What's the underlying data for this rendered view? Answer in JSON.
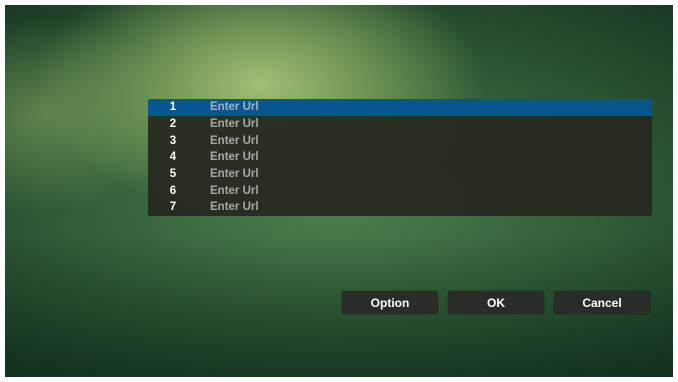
{
  "url_list": {
    "selected_index": 0,
    "rows": [
      {
        "number": "1",
        "placeholder": "Enter Url"
      },
      {
        "number": "2",
        "placeholder": "Enter Url"
      },
      {
        "number": "3",
        "placeholder": "Enter Url"
      },
      {
        "number": "4",
        "placeholder": "Enter Url"
      },
      {
        "number": "5",
        "placeholder": "Enter Url"
      },
      {
        "number": "6",
        "placeholder": "Enter Url"
      },
      {
        "number": "7",
        "placeholder": "Enter Url"
      }
    ]
  },
  "buttons": {
    "option_label": "Option",
    "ok_label": "OK",
    "cancel_label": "Cancel"
  },
  "colors": {
    "selection": "#07568f",
    "list_background": "#26281f",
    "button_background": "#2a2d27"
  }
}
